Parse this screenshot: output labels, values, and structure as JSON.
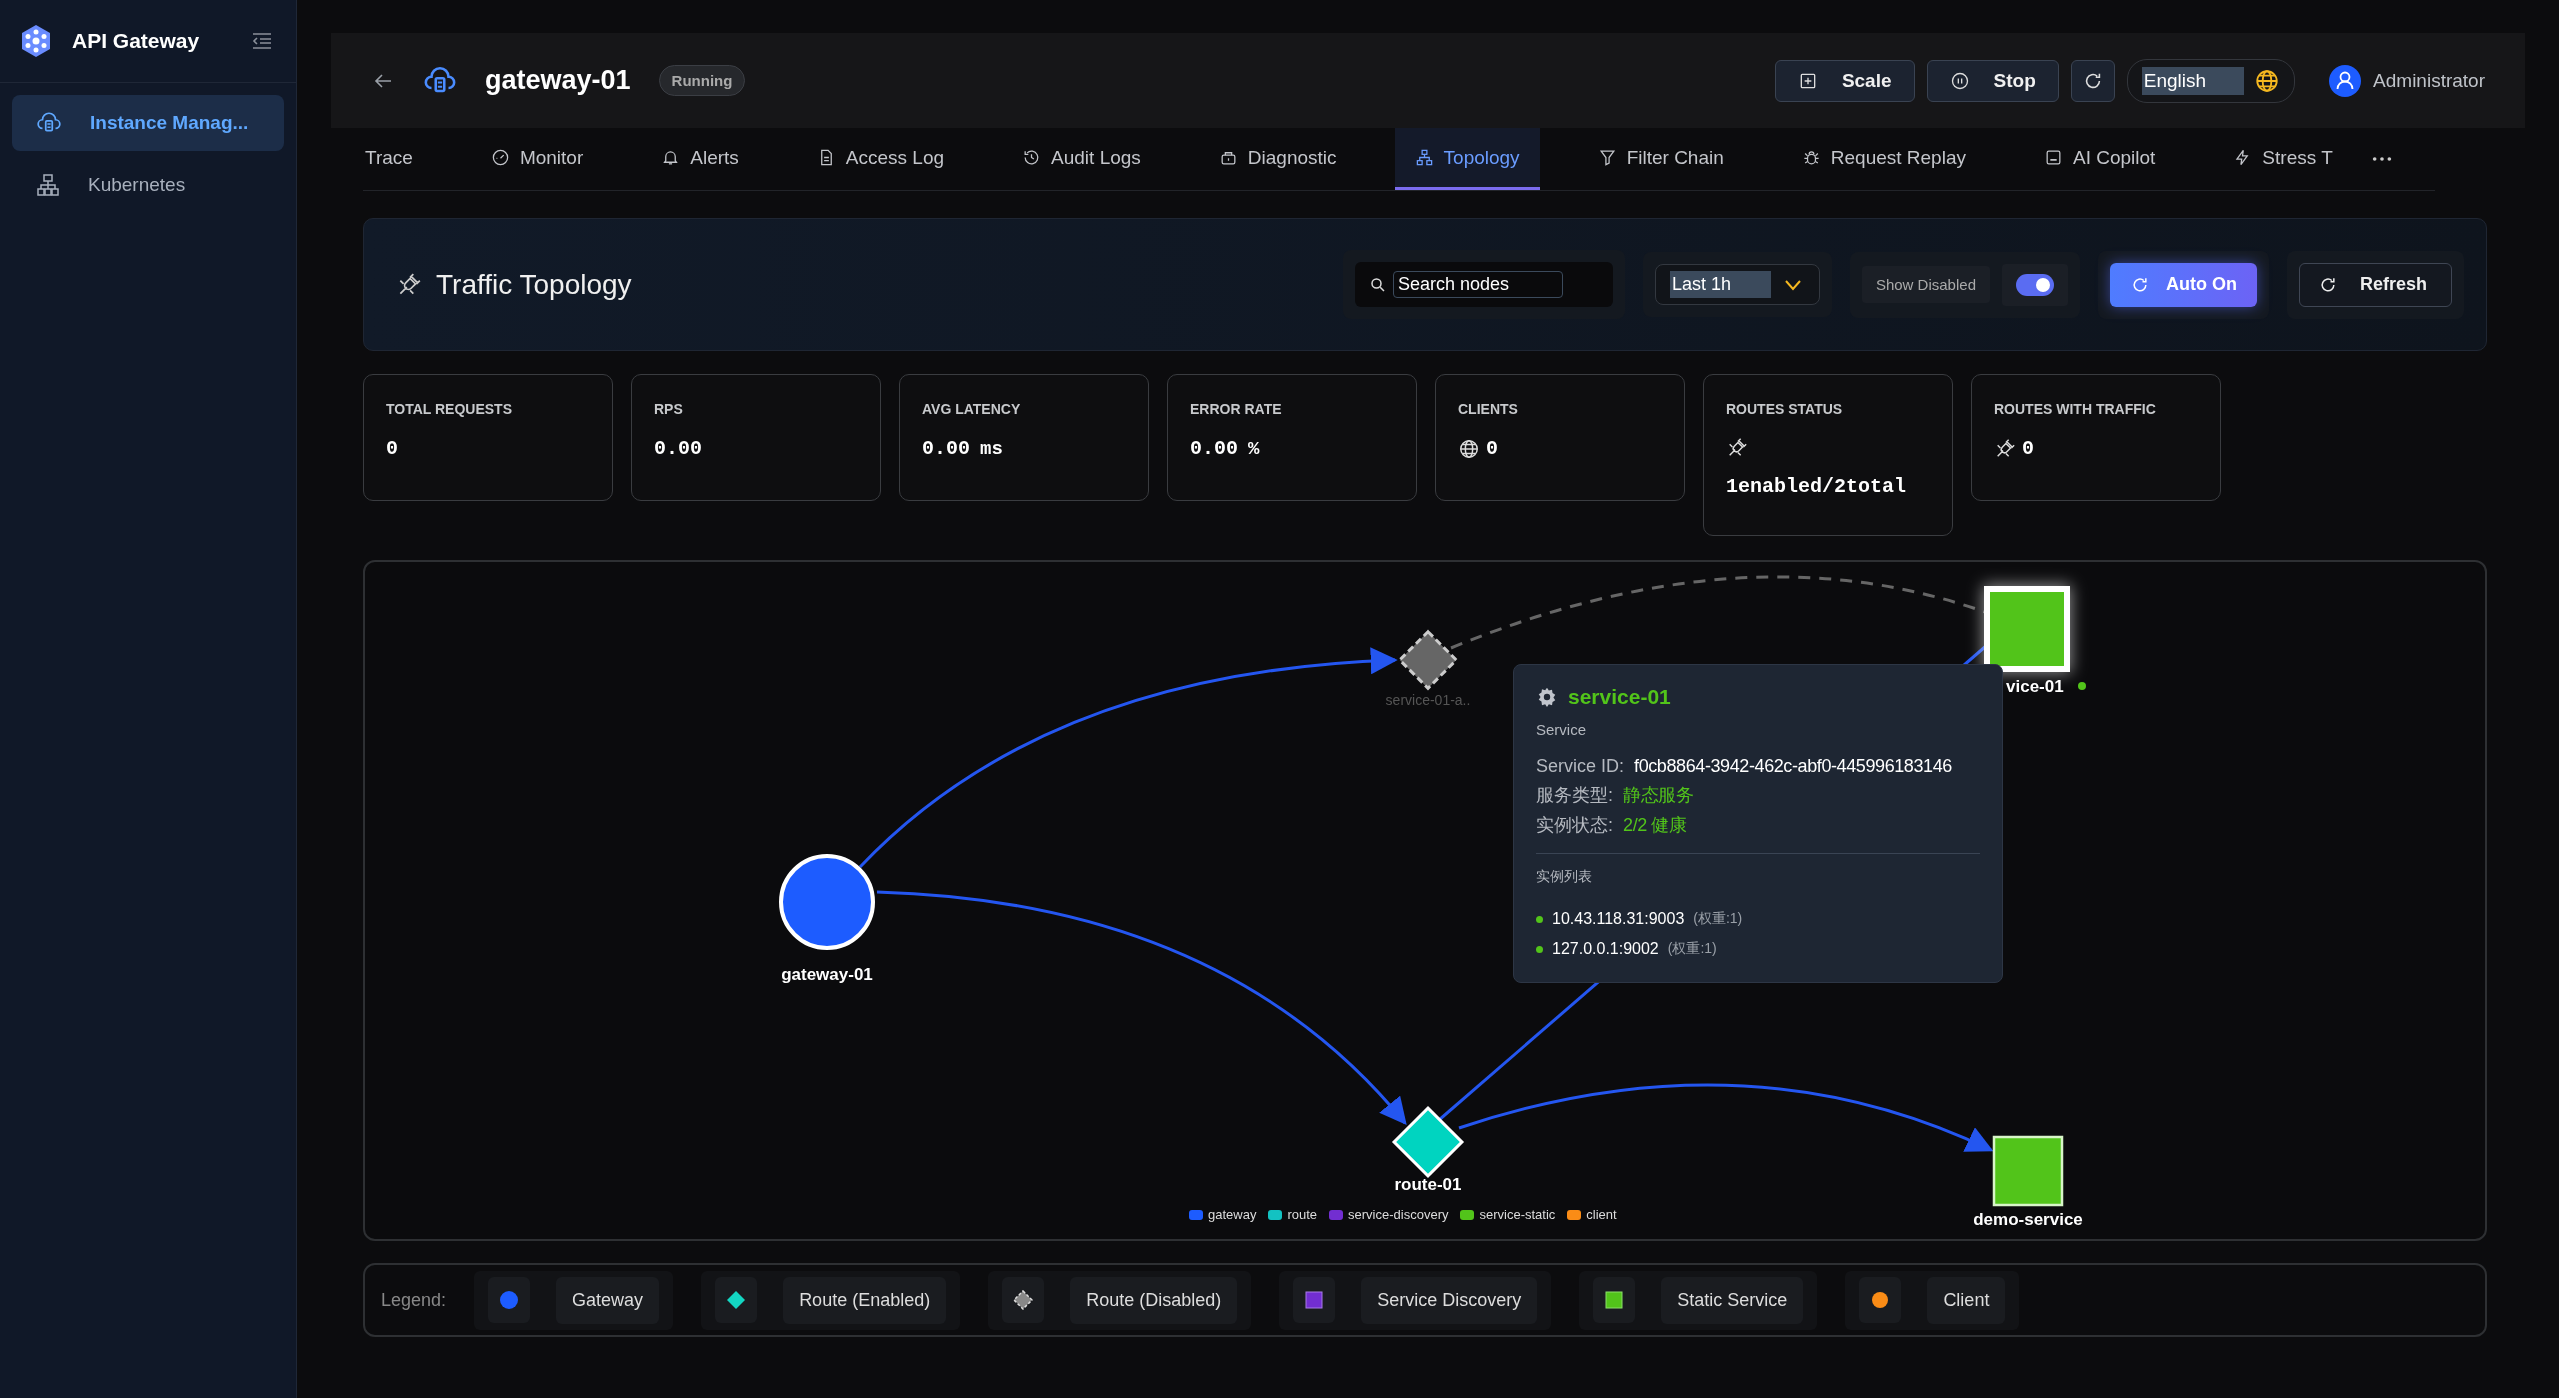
{
  "sidebar": {
    "brand": "API Gateway",
    "items": [
      {
        "label": "Instance Manag...",
        "selected": true
      },
      {
        "label": "Kubernetes",
        "selected": false
      }
    ]
  },
  "header": {
    "title": "gateway-01",
    "status": "Running",
    "buttons": [
      {
        "label": "Scale"
      },
      {
        "label": "Stop"
      }
    ],
    "language": "English",
    "user": "Administrator"
  },
  "tabs": [
    {
      "label": "Trace",
      "selected": false
    },
    {
      "label": "Monitor",
      "selected": false
    },
    {
      "label": "Alerts",
      "selected": false
    },
    {
      "label": "Access Log",
      "selected": false
    },
    {
      "label": "Audit Logs",
      "selected": false
    },
    {
      "label": "Diagnostic",
      "selected": false
    },
    {
      "label": "Topology",
      "selected": true
    },
    {
      "label": "Filter Chain",
      "selected": false
    },
    {
      "label": "Request Replay",
      "selected": false
    },
    {
      "label": "AI Copilot",
      "selected": false
    },
    {
      "label": "Stress T",
      "selected": false
    }
  ],
  "toolbar": {
    "title": "Traffic Topology",
    "search": {
      "placeholder": "Search nodes"
    },
    "time_range": "Last 1h",
    "show_disabled": {
      "label": "Show Disabled",
      "on": true
    },
    "auto": {
      "label": "Auto On",
      "on": true
    },
    "refresh": "Refresh"
  },
  "stats": [
    {
      "label": "TOTAL REQUESTS",
      "value": "0",
      "kind": "plain"
    },
    {
      "label": "RPS",
      "value": "0.00",
      "kind": "plain"
    },
    {
      "label": "AVG LATENCY",
      "value": "0.00",
      "unit": "ms",
      "kind": "plain"
    },
    {
      "label": "ERROR RATE",
      "value": "0.00",
      "unit": "%",
      "kind": "plain"
    },
    {
      "label": "CLIENTS",
      "value": "0",
      "kind": "globe"
    },
    {
      "label": "ROUTES STATUS",
      "value": "1enabled/2total",
      "kind": "plug-above"
    },
    {
      "label": "ROUTES WITH TRAFFIC",
      "value": "0",
      "kind": "plug"
    }
  ],
  "graph": {
    "nodes": [
      {
        "kind": "gateway",
        "label": "gateway-01",
        "healthy": false
      },
      {
        "kind": "route-disabled",
        "label": "service-01-a..",
        "healthy": false
      },
      {
        "kind": "service-highlight",
        "label": "vice-01",
        "healthy": true
      },
      {
        "kind": "route",
        "label": "route-01",
        "healthy": false
      },
      {
        "kind": "service",
        "label": "demo-service",
        "healthy": false
      }
    ],
    "legend": [
      {
        "label": "gateway",
        "color": "#1d5cff"
      },
      {
        "label": "route",
        "color": "#13c2c2"
      },
      {
        "label": "service-discovery",
        "color": "#722ed1"
      },
      {
        "label": "service-static",
        "color": "#52c41a"
      },
      {
        "label": "client",
        "color": "#fa8c16"
      }
    ],
    "tooltip": {
      "title": "service-01",
      "type": "Service",
      "fields": [
        {
          "label": "Service ID:",
          "value": "f0cb8864-3942-462c-abf0-445996183146",
          "kind": "plain"
        },
        {
          "label": "服务类型:",
          "value": "静态服务",
          "kind": "highlight"
        },
        {
          "label": "实例状态:",
          "value": "2/2 健康",
          "kind": "highlight"
        }
      ],
      "section": "实例列表",
      "instances": [
        {
          "address": "10.43.118.31:9003",
          "weight": "(权重:1)"
        },
        {
          "address": "127.0.0.1:9002",
          "weight": "(权重:1)"
        }
      ]
    }
  },
  "legend": {
    "label": "Legend:",
    "items": [
      {
        "kind": "gateway",
        "label": "Gateway"
      },
      {
        "kind": "route",
        "label": "Route (Enabled)"
      },
      {
        "kind": "route-disabled",
        "label": "Route (Disabled)"
      },
      {
        "kind": "discovery",
        "label": "Service Discovery"
      },
      {
        "kind": "static",
        "label": "Static Service"
      },
      {
        "kind": "client",
        "label": "Client"
      }
    ]
  }
}
